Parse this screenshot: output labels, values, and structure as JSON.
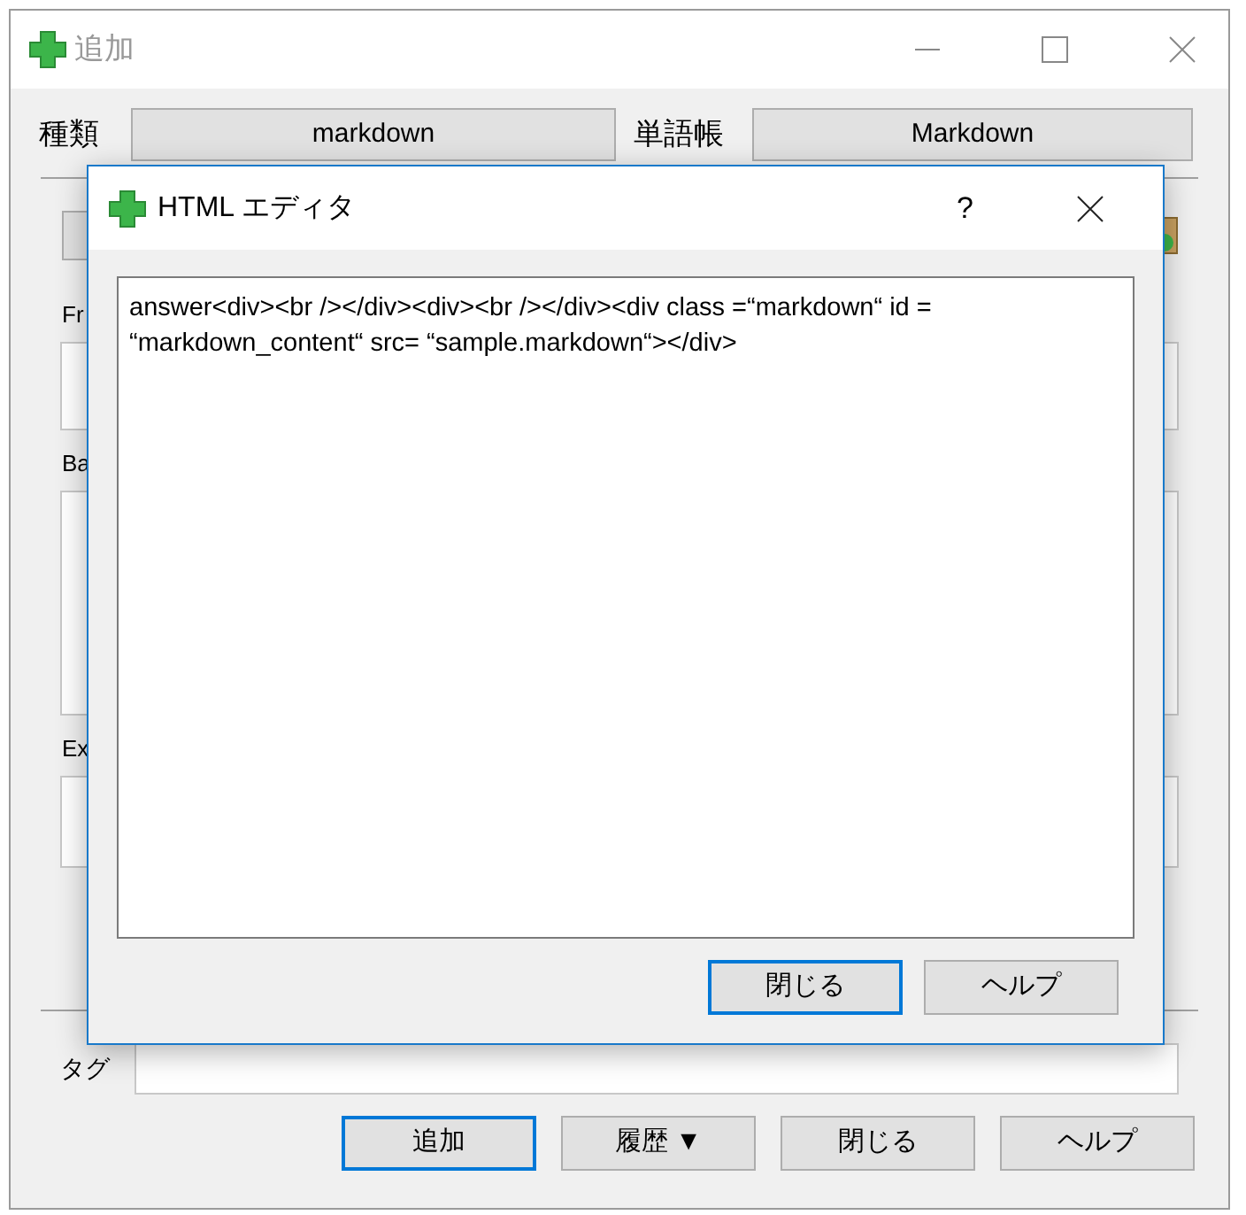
{
  "window": {
    "title": "追加"
  },
  "type_row": {
    "type_label": "種類",
    "type_value": "markdown",
    "deck_label": "単語帳",
    "deck_value": "Markdown"
  },
  "fields": [
    {
      "label": "Fr"
    },
    {
      "label": "Ba"
    },
    {
      "label": "Ex"
    }
  ],
  "tags": {
    "label": "タグ"
  },
  "buttons": [
    {
      "label": "追加",
      "default": true
    },
    {
      "label": "履歴 ▼",
      "default": false
    },
    {
      "label": "閉じる",
      "default": false
    },
    {
      "label": "ヘルプ",
      "default": false
    }
  ],
  "dialog": {
    "title": "HTML エディタ",
    "help": "?",
    "content": "answer<div><br /></div><div><br /></div><div class =“markdown“ id = “markdown_content“ src= “sample.markdown“></div>",
    "buttons": [
      {
        "label": "閉じる",
        "default": true
      },
      {
        "label": "ヘルプ",
        "default": false
      }
    ]
  }
}
